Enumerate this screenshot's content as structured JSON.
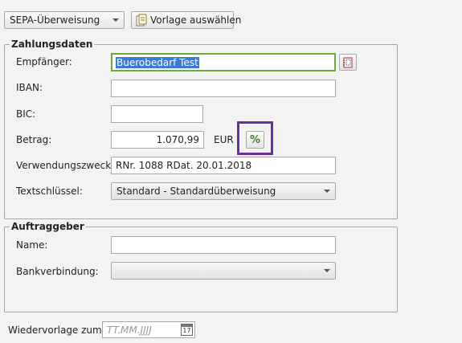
{
  "toolbar": {
    "transfer_type": "SEPA-Überweisung",
    "template_button": "Vorlage auswählen"
  },
  "payment": {
    "legend": "Zahlungsdaten",
    "recipient_label": "Empfänger:",
    "recipient_value": "Buerobedarf Test",
    "iban_label": "IBAN:",
    "iban_value": "",
    "bic_label": "BIC:",
    "bic_value": "",
    "amount_label": "Betrag:",
    "amount_value": "1.070,99",
    "currency": "EUR",
    "percent_symbol": "%",
    "purpose_label": "Verwendungszweck:",
    "purpose_value": "RNr. 1088 RDat. 20.01.2018",
    "textkey_label": "Textschlüssel:",
    "textkey_value": "Standard - Standardüberweisung"
  },
  "principal": {
    "legend": "Auftraggeber",
    "name_label": "Name:",
    "name_value": "",
    "bank_label": "Bankverbindung:",
    "bank_value": ""
  },
  "resubmission": {
    "label": "Wiedervorlage zum:",
    "placeholder": "TT.MM.JJJJ",
    "calendar_day": "17"
  },
  "icons": {
    "document": "document-icon",
    "address_book": "address-book-icon",
    "percent": "percent-icon",
    "calendar": "calendar-icon"
  },
  "colors": {
    "focus_border": "#6aaa3a",
    "highlight_border": "#6b2fa0",
    "selection": "#3a7bd5"
  }
}
